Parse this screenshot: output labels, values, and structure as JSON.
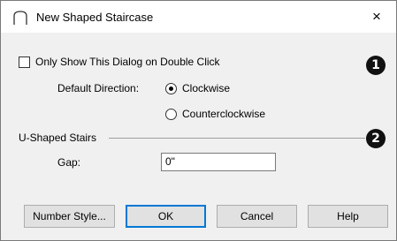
{
  "window": {
    "title": "New Shaped Staircase",
    "close_glyph": "×"
  },
  "options": {
    "double_click_label": "Only Show This Dialog on Double Click",
    "double_click_checked": false
  },
  "direction": {
    "label": "Default Direction:",
    "options": [
      {
        "label": "Clockwise",
        "selected": true
      },
      {
        "label": "Counterclockwise",
        "selected": false
      }
    ]
  },
  "u_shaped": {
    "group_label": "U-Shaped Stairs",
    "gap_label": "Gap:",
    "gap_value": "0\""
  },
  "callouts": {
    "first": "1",
    "second": "2"
  },
  "buttons": {
    "number_style": "Number Style...",
    "ok": "OK",
    "cancel": "Cancel",
    "help": "Help"
  },
  "colors": {
    "accent": "#0078d7",
    "dialog_bg": "#f0f0f0",
    "badge": "#111111"
  }
}
